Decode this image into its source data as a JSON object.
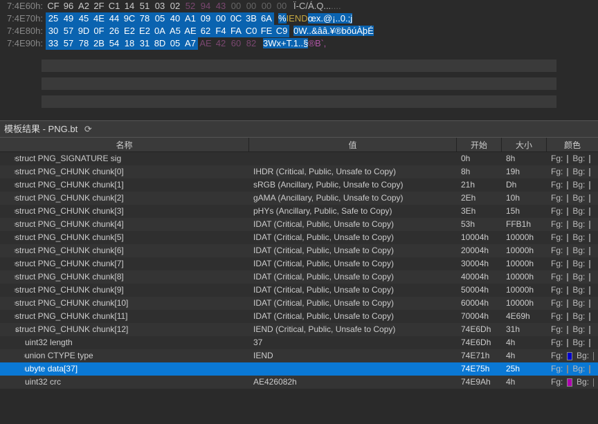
{
  "hex": {
    "rows": [
      {
        "offset": "7:4E60h:",
        "bytes": [
          "CF",
          "96",
          "A2",
          "2F",
          "C1",
          "14",
          "51",
          "03",
          "02",
          "52",
          "94",
          "43",
          "00",
          "00",
          "00",
          "00"
        ],
        "styles": [
          "",
          "",
          "",
          "",
          "",
          "",
          "",
          "",
          "",
          "dim",
          "dim",
          "dim",
          "zero",
          "zero",
          "zero",
          "zero"
        ],
        "ascii": "Ï-C/Á.Q...",
        "asciiExtra": "...."
      },
      {
        "offset": "7:4E70h:",
        "bytes": [
          "25",
          "49",
          "45",
          "4E",
          "44",
          "9C",
          "78",
          "05",
          "40",
          "A1",
          "09",
          "00",
          "0C",
          "3B",
          "6A"
        ],
        "styles": [
          "sel",
          "sel",
          "sel",
          "sel",
          "sel",
          "sel",
          "sel",
          "sel",
          "sel",
          "sel",
          "sel",
          "sel",
          "sel",
          "sel",
          "sel"
        ],
        "asciiParts": [
          {
            "t": "%",
            "c": "sel"
          },
          {
            "t": "IEND",
            "c": "y"
          },
          {
            "t": "œx.@¡..0.;j",
            "c": "sel"
          }
        ]
      },
      {
        "offset": "7:4E80h:",
        "bytes": [
          "30",
          "57",
          "9D",
          "0F",
          "26",
          "E2",
          "E2",
          "0A",
          "A5",
          "AE",
          "62",
          "F4",
          "FA",
          "C0",
          "FE",
          "C9"
        ],
        "styles": [
          "sel",
          "sel",
          "sel",
          "sel",
          "sel",
          "sel",
          "sel",
          "sel",
          "sel",
          "sel",
          "sel",
          "sel",
          "sel",
          "sel",
          "sel",
          "sel"
        ],
        "asciiParts": [
          {
            "t": "0W..&ââ.¥®bôúÀþÉ",
            "c": "sel"
          }
        ]
      },
      {
        "offset": "7:4E90h:",
        "bytes": [
          "33",
          "57",
          "78",
          "2B",
          "54",
          "18",
          "31",
          "8D",
          "05",
          "A7",
          "AE",
          "42",
          "60",
          "82"
        ],
        "styles": [
          "sel",
          "sel",
          "sel",
          "sel",
          "sel",
          "sel",
          "sel",
          "sel",
          "sel",
          "sel",
          "dim",
          "dim",
          "dim",
          "dim"
        ],
        "asciiParts": [
          {
            "t": "3Wx+T.1..",
            "c": "sel"
          },
          {
            "t": "§",
            "c": "sel"
          },
          {
            "t": "®B`‚",
            "c": "p"
          }
        ]
      }
    ]
  },
  "panel": {
    "title": "模板结果 - PNG.bt",
    "modified": "⟳"
  },
  "headers": {
    "name": "名称",
    "value": "值",
    "start": "开始",
    "size": "大小",
    "color": "颜色"
  },
  "fg": "Fg:",
  "bg": "Bg:",
  "rows": [
    {
      "name": "struct PNG_SIGNATURE sig",
      "val": "",
      "start": "0h",
      "size": "8h",
      "tw": "›",
      "ind": 1
    },
    {
      "name": "struct PNG_CHUNK chunk[0]",
      "val": "IHDR  (Critical, Public, Unsafe to Copy)",
      "start": "8h",
      "size": "19h",
      "tw": "›",
      "ind": 1
    },
    {
      "name": "struct PNG_CHUNK chunk[1]",
      "val": "sRGB  (Ancillary, Public, Unsafe to Copy)",
      "start": "21h",
      "size": "Dh",
      "tw": "›",
      "ind": 1
    },
    {
      "name": "struct PNG_CHUNK chunk[2]",
      "val": "gAMA  (Ancillary, Public, Unsafe to Copy)",
      "start": "2Eh",
      "size": "10h",
      "tw": "›",
      "ind": 1
    },
    {
      "name": "struct PNG_CHUNK chunk[3]",
      "val": "pHYs  (Ancillary, Public, Safe to Copy)",
      "start": "3Eh",
      "size": "15h",
      "tw": "›",
      "ind": 1
    },
    {
      "name": "struct PNG_CHUNK chunk[4]",
      "val": "IDAT  (Critical, Public, Unsafe to Copy)",
      "start": "53h",
      "size": "FFB1h",
      "tw": "›",
      "ind": 1
    },
    {
      "name": "struct PNG_CHUNK chunk[5]",
      "val": "IDAT  (Critical, Public, Unsafe to Copy)",
      "start": "10004h",
      "size": "10000h",
      "tw": "›",
      "ind": 1
    },
    {
      "name": "struct PNG_CHUNK chunk[6]",
      "val": "IDAT  (Critical, Public, Unsafe to Copy)",
      "start": "20004h",
      "size": "10000h",
      "tw": "›",
      "ind": 1
    },
    {
      "name": "struct PNG_CHUNK chunk[7]",
      "val": "IDAT  (Critical, Public, Unsafe to Copy)",
      "start": "30004h",
      "size": "10000h",
      "tw": "›",
      "ind": 1
    },
    {
      "name": "struct PNG_CHUNK chunk[8]",
      "val": "IDAT  (Critical, Public, Unsafe to Copy)",
      "start": "40004h",
      "size": "10000h",
      "tw": "›",
      "ind": 1
    },
    {
      "name": "struct PNG_CHUNK chunk[9]",
      "val": "IDAT  (Critical, Public, Unsafe to Copy)",
      "start": "50004h",
      "size": "10000h",
      "tw": "›",
      "ind": 1
    },
    {
      "name": "struct PNG_CHUNK chunk[10]",
      "val": "IDAT  (Critical, Public, Unsafe to Copy)",
      "start": "60004h",
      "size": "10000h",
      "tw": "›",
      "ind": 1
    },
    {
      "name": "struct PNG_CHUNK chunk[11]",
      "val": "IDAT  (Critical, Public, Unsafe to Copy)",
      "start": "70004h",
      "size": "4E69h",
      "tw": "›",
      "ind": 1
    },
    {
      "name": "struct PNG_CHUNK chunk[12]",
      "val": "IEND  (Critical, Public, Unsafe to Copy)",
      "start": "74E6Dh",
      "size": "31h",
      "tw": "⌄",
      "ind": 1
    },
    {
      "name": "uint32 length",
      "val": "37",
      "start": "74E6Dh",
      "size": "4h",
      "tw": "",
      "ind": 2
    },
    {
      "name": "union CTYPE type",
      "val": "IEND",
      "start": "74E71h",
      "size": "4h",
      "tw": "›",
      "ind": 2,
      "fgc": "#0000cc"
    },
    {
      "name": "ubyte data[37]",
      "val": "",
      "start": "74E75h",
      "size": "25h",
      "tw": "›",
      "ind": 2,
      "sel": true
    },
    {
      "name": "uint32 crc",
      "val": "AE426082h",
      "start": "74E9Ah",
      "size": "4h",
      "tw": "",
      "ind": 2,
      "fgc": "#b000b0"
    }
  ]
}
